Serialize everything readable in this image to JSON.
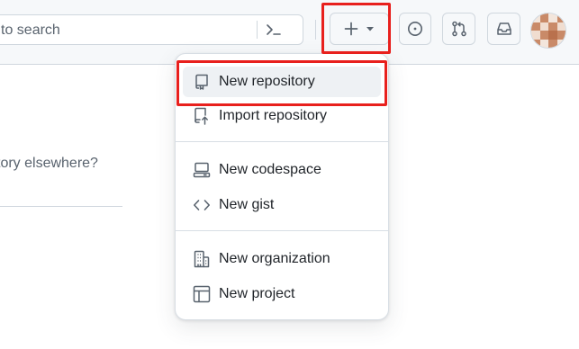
{
  "search": {
    "placeholder": "to search"
  },
  "header": {
    "plus_icon": "plus-icon",
    "caret_icon": "triangle-down-icon",
    "issues_icon": "issue-opened-icon",
    "pulls_icon": "git-pull-request-icon",
    "inbox_icon": "inbox-icon"
  },
  "page": {
    "text": "tory elsewhere?"
  },
  "menu": {
    "items": [
      {
        "label": "New repository",
        "icon": "repo-icon"
      },
      {
        "label": "Import repository",
        "icon": "repo-push-icon"
      },
      {
        "label": "New codespace",
        "icon": "codespaces-icon"
      },
      {
        "label": "New gist",
        "icon": "code-icon"
      },
      {
        "label": "New organization",
        "icon": "organization-icon"
      },
      {
        "label": "New project",
        "icon": "table-icon"
      }
    ]
  },
  "colors": {
    "highlight": "#e8201d",
    "text": "#1f2328",
    "muted": "#59636e",
    "border": "#d0d7de",
    "header_bg": "#f6f8fa"
  }
}
